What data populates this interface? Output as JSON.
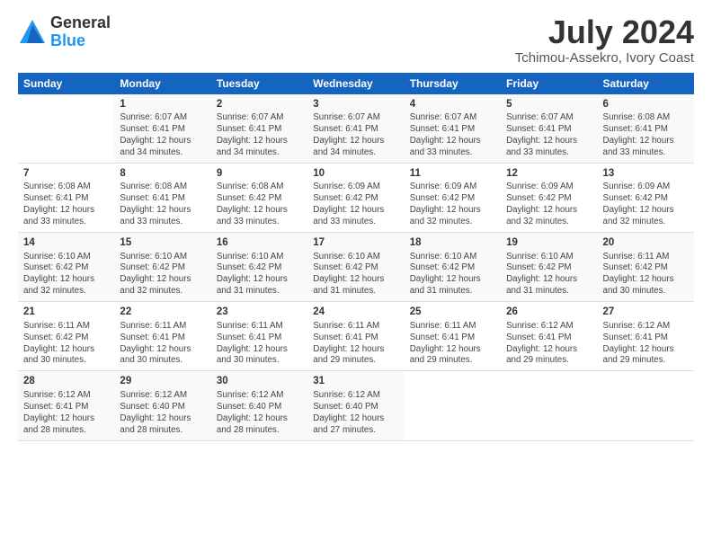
{
  "logo": {
    "general": "General",
    "blue": "Blue"
  },
  "title": "July 2024",
  "subtitle": "Tchimou-Assekro, Ivory Coast",
  "header_days": [
    "Sunday",
    "Monday",
    "Tuesday",
    "Wednesday",
    "Thursday",
    "Friday",
    "Saturday"
  ],
  "weeks": [
    [
      {
        "day": "",
        "info": ""
      },
      {
        "day": "1",
        "info": "Sunrise: 6:07 AM\nSunset: 6:41 PM\nDaylight: 12 hours\nand 34 minutes."
      },
      {
        "day": "2",
        "info": "Sunrise: 6:07 AM\nSunset: 6:41 PM\nDaylight: 12 hours\nand 34 minutes."
      },
      {
        "day": "3",
        "info": "Sunrise: 6:07 AM\nSunset: 6:41 PM\nDaylight: 12 hours\nand 34 minutes."
      },
      {
        "day": "4",
        "info": "Sunrise: 6:07 AM\nSunset: 6:41 PM\nDaylight: 12 hours\nand 33 minutes."
      },
      {
        "day": "5",
        "info": "Sunrise: 6:07 AM\nSunset: 6:41 PM\nDaylight: 12 hours\nand 33 minutes."
      },
      {
        "day": "6",
        "info": "Sunrise: 6:08 AM\nSunset: 6:41 PM\nDaylight: 12 hours\nand 33 minutes."
      }
    ],
    [
      {
        "day": "7",
        "info": "Sunrise: 6:08 AM\nSunset: 6:41 PM\nDaylight: 12 hours\nand 33 minutes."
      },
      {
        "day": "8",
        "info": "Sunrise: 6:08 AM\nSunset: 6:41 PM\nDaylight: 12 hours\nand 33 minutes."
      },
      {
        "day": "9",
        "info": "Sunrise: 6:08 AM\nSunset: 6:42 PM\nDaylight: 12 hours\nand 33 minutes."
      },
      {
        "day": "10",
        "info": "Sunrise: 6:09 AM\nSunset: 6:42 PM\nDaylight: 12 hours\nand 33 minutes."
      },
      {
        "day": "11",
        "info": "Sunrise: 6:09 AM\nSunset: 6:42 PM\nDaylight: 12 hours\nand 32 minutes."
      },
      {
        "day": "12",
        "info": "Sunrise: 6:09 AM\nSunset: 6:42 PM\nDaylight: 12 hours\nand 32 minutes."
      },
      {
        "day": "13",
        "info": "Sunrise: 6:09 AM\nSunset: 6:42 PM\nDaylight: 12 hours\nand 32 minutes."
      }
    ],
    [
      {
        "day": "14",
        "info": "Sunrise: 6:10 AM\nSunset: 6:42 PM\nDaylight: 12 hours\nand 32 minutes."
      },
      {
        "day": "15",
        "info": "Sunrise: 6:10 AM\nSunset: 6:42 PM\nDaylight: 12 hours\nand 32 minutes."
      },
      {
        "day": "16",
        "info": "Sunrise: 6:10 AM\nSunset: 6:42 PM\nDaylight: 12 hours\nand 31 minutes."
      },
      {
        "day": "17",
        "info": "Sunrise: 6:10 AM\nSunset: 6:42 PM\nDaylight: 12 hours\nand 31 minutes."
      },
      {
        "day": "18",
        "info": "Sunrise: 6:10 AM\nSunset: 6:42 PM\nDaylight: 12 hours\nand 31 minutes."
      },
      {
        "day": "19",
        "info": "Sunrise: 6:10 AM\nSunset: 6:42 PM\nDaylight: 12 hours\nand 31 minutes."
      },
      {
        "day": "20",
        "info": "Sunrise: 6:11 AM\nSunset: 6:42 PM\nDaylight: 12 hours\nand 30 minutes."
      }
    ],
    [
      {
        "day": "21",
        "info": "Sunrise: 6:11 AM\nSunset: 6:42 PM\nDaylight: 12 hours\nand 30 minutes."
      },
      {
        "day": "22",
        "info": "Sunrise: 6:11 AM\nSunset: 6:41 PM\nDaylight: 12 hours\nand 30 minutes."
      },
      {
        "day": "23",
        "info": "Sunrise: 6:11 AM\nSunset: 6:41 PM\nDaylight: 12 hours\nand 30 minutes."
      },
      {
        "day": "24",
        "info": "Sunrise: 6:11 AM\nSunset: 6:41 PM\nDaylight: 12 hours\nand 29 minutes."
      },
      {
        "day": "25",
        "info": "Sunrise: 6:11 AM\nSunset: 6:41 PM\nDaylight: 12 hours\nand 29 minutes."
      },
      {
        "day": "26",
        "info": "Sunrise: 6:12 AM\nSunset: 6:41 PM\nDaylight: 12 hours\nand 29 minutes."
      },
      {
        "day": "27",
        "info": "Sunrise: 6:12 AM\nSunset: 6:41 PM\nDaylight: 12 hours\nand 29 minutes."
      }
    ],
    [
      {
        "day": "28",
        "info": "Sunrise: 6:12 AM\nSunset: 6:41 PM\nDaylight: 12 hours\nand 28 minutes."
      },
      {
        "day": "29",
        "info": "Sunrise: 6:12 AM\nSunset: 6:40 PM\nDaylight: 12 hours\nand 28 minutes."
      },
      {
        "day": "30",
        "info": "Sunrise: 6:12 AM\nSunset: 6:40 PM\nDaylight: 12 hours\nand 28 minutes."
      },
      {
        "day": "31",
        "info": "Sunrise: 6:12 AM\nSunset: 6:40 PM\nDaylight: 12 hours\nand 27 minutes."
      },
      {
        "day": "",
        "info": ""
      },
      {
        "day": "",
        "info": ""
      },
      {
        "day": "",
        "info": ""
      }
    ]
  ]
}
